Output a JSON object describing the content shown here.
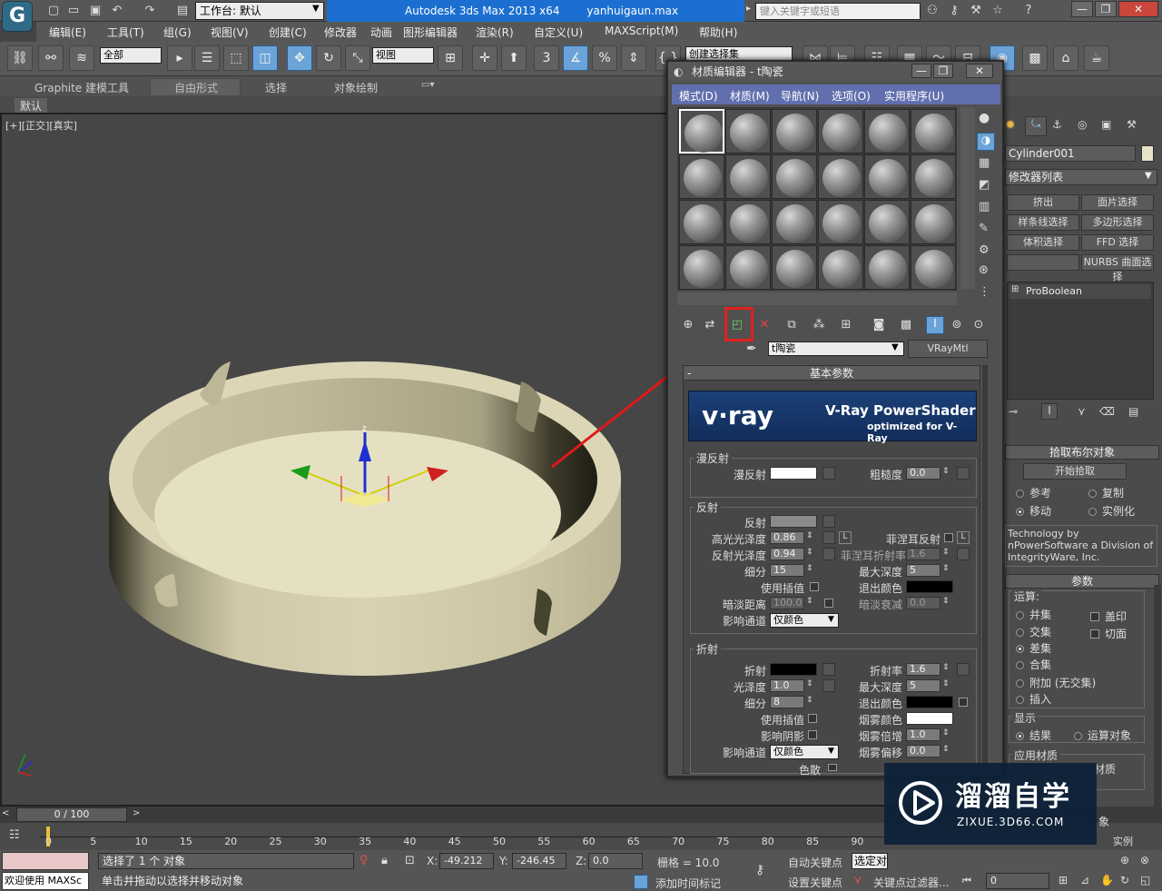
{
  "title": {
    "app": "Autodesk 3ds Max  2013 x64",
    "file": "yanhuigaun.max",
    "workspace": "工作台: 默认",
    "search_placeholder": "键入关键字或短语"
  },
  "menus": [
    "编辑(E)",
    "工具(T)",
    "组(G)",
    "视图(V)",
    "创建(C)",
    "修改器",
    "动画",
    "图形编辑器",
    "渲染(R)",
    "自定义(U)",
    "MAXScript(M)",
    "帮助(H)"
  ],
  "toolbar": {
    "selection_filter": "全部",
    "ref_coord": "视图",
    "named_selection": "创建选择集"
  },
  "ribbon": {
    "tabs": [
      "Graphite 建模工具",
      "自由形式",
      "选择",
      "对象绘制"
    ],
    "subtab": "默认"
  },
  "viewport": {
    "label": "[+][正交][真实]"
  },
  "material_editor": {
    "title": "材质编辑器 - t陶瓷",
    "menus": [
      "模式(D)",
      "材质(M)",
      "导航(N)",
      "选项(O)",
      "实用程序(U)"
    ],
    "material_name": "t陶瓷",
    "material_type": "VRayMtl",
    "rollout_title": "基本参数",
    "banner": {
      "brand": "v·ray",
      "product": "V-Ray PowerShader",
      "tagline": "optimized for V-Ray"
    },
    "diffuse": {
      "group": "漫反射",
      "diffuse_label": "漫反射",
      "diffuse_color": "#ffffff",
      "roughness_label": "粗糙度",
      "roughness": "0.0"
    },
    "reflection": {
      "group": "反射",
      "reflect_label": "反射",
      "reflect_color": "#8a8a8a",
      "hilight_gloss_label": "高光光泽度",
      "hilight_gloss": "0.86",
      "refl_gloss_label": "反射光泽度",
      "refl_gloss": "0.94",
      "subdivs_label": "细分",
      "subdivs": "15",
      "use_interp_label": "使用插值",
      "dim_dist_label": "暗淡距离",
      "dim_dist": "100.0",
      "affect_channels_label": "影响通道",
      "affect_channels": "仅颜色",
      "fresnel_label": "菲涅耳反射",
      "fresnel_ior_label": "菲涅耳折射率",
      "fresnel_ior": "1.6",
      "max_depth_label": "最大深度",
      "max_depth": "5",
      "exit_color_label": "退出颜色",
      "exit_color": "#000000",
      "dim_falloff_label": "暗淡衰减",
      "dim_falloff": "0.0",
      "lock": "L"
    },
    "refraction": {
      "group": "折射",
      "refract_label": "折射",
      "refract_color": "#000000",
      "gloss_label": "光泽度",
      "gloss": "1.0",
      "subdivs_label": "细分",
      "subdivs": "8",
      "use_interp_label": "使用插值",
      "affect_shadows_label": "影响阴影",
      "affect_channels_label": "影响通道",
      "affect_channels": "仅颜色",
      "dispersion_label": "色散",
      "ior_label": "折射率",
      "ior": "1.6",
      "max_depth_label": "最大深度",
      "max_depth": "5",
      "exit_color_label": "退出颜色",
      "exit_color": "#000000",
      "fog_color_label": "烟雾颜色",
      "fog_color": "#ffffff",
      "fog_mult_label": "烟雾倍增",
      "fog_mult": "1.0",
      "fog_bias_label": "烟雾偏移",
      "fog_bias": "0.0"
    }
  },
  "command_panel": {
    "object_name": "Cylinder001",
    "object_color": "#e8e2c8",
    "modifier_list": "修改器列表",
    "modifier_buttons": [
      "挤出",
      "面片选择",
      "样条线选择",
      "多边形选择",
      "体积选择",
      "FFD 选择",
      "",
      "NURBS 曲面选择"
    ],
    "stack_item": "ProBoolean",
    "pick_rollout": "拾取布尔对象",
    "start_pick": "开始拾取",
    "pick_options": [
      "参考",
      "复制",
      "移动",
      "实例化"
    ],
    "credits": "Technology by nPowerSoftware a Division of IntegrityWare, Inc.",
    "params_rollout": "参数",
    "operation_label": "运算:",
    "operations": [
      "并集",
      "交集",
      "差集",
      "合集",
      "附加 (无交集)",
      "插入"
    ],
    "op_checks": [
      "盖印",
      "切面"
    ],
    "display_label": "显示",
    "display_options": [
      "结果",
      "运算对象"
    ],
    "apply_material_label": "应用材质",
    "apply_material_text": "材质"
  },
  "timeline": {
    "frame": "0 / 100",
    "ticks": [
      "0",
      "5",
      "10",
      "15",
      "20",
      "25",
      "30",
      "35",
      "40",
      "45",
      "50",
      "55",
      "60",
      "65",
      "70",
      "75",
      "80",
      "85",
      "90"
    ]
  },
  "status": {
    "selected": "选择了 1 个 对象",
    "prompt": "单击并拖动以选择并移动对象",
    "welcome": "欢迎使用 MAXSc",
    "x_label": "X:",
    "x": "-49.212",
    "y_label": "Y:",
    "y": "-246.45",
    "z_label": "Z:",
    "z": "0.0",
    "grid": "栅格 = 10.0",
    "auto_key": "自动关键点",
    "set_key": "设置关键点",
    "selected_set": "选定对",
    "key_filters": "关键点过滤器...",
    "add_time_tag": "添加时间标记",
    "current_frame": "0"
  },
  "watermark": {
    "title": "溜溜自学",
    "url": "ZIXUE.3D66.COM",
    "behind_text": "象",
    "behind_text2": "实例"
  }
}
